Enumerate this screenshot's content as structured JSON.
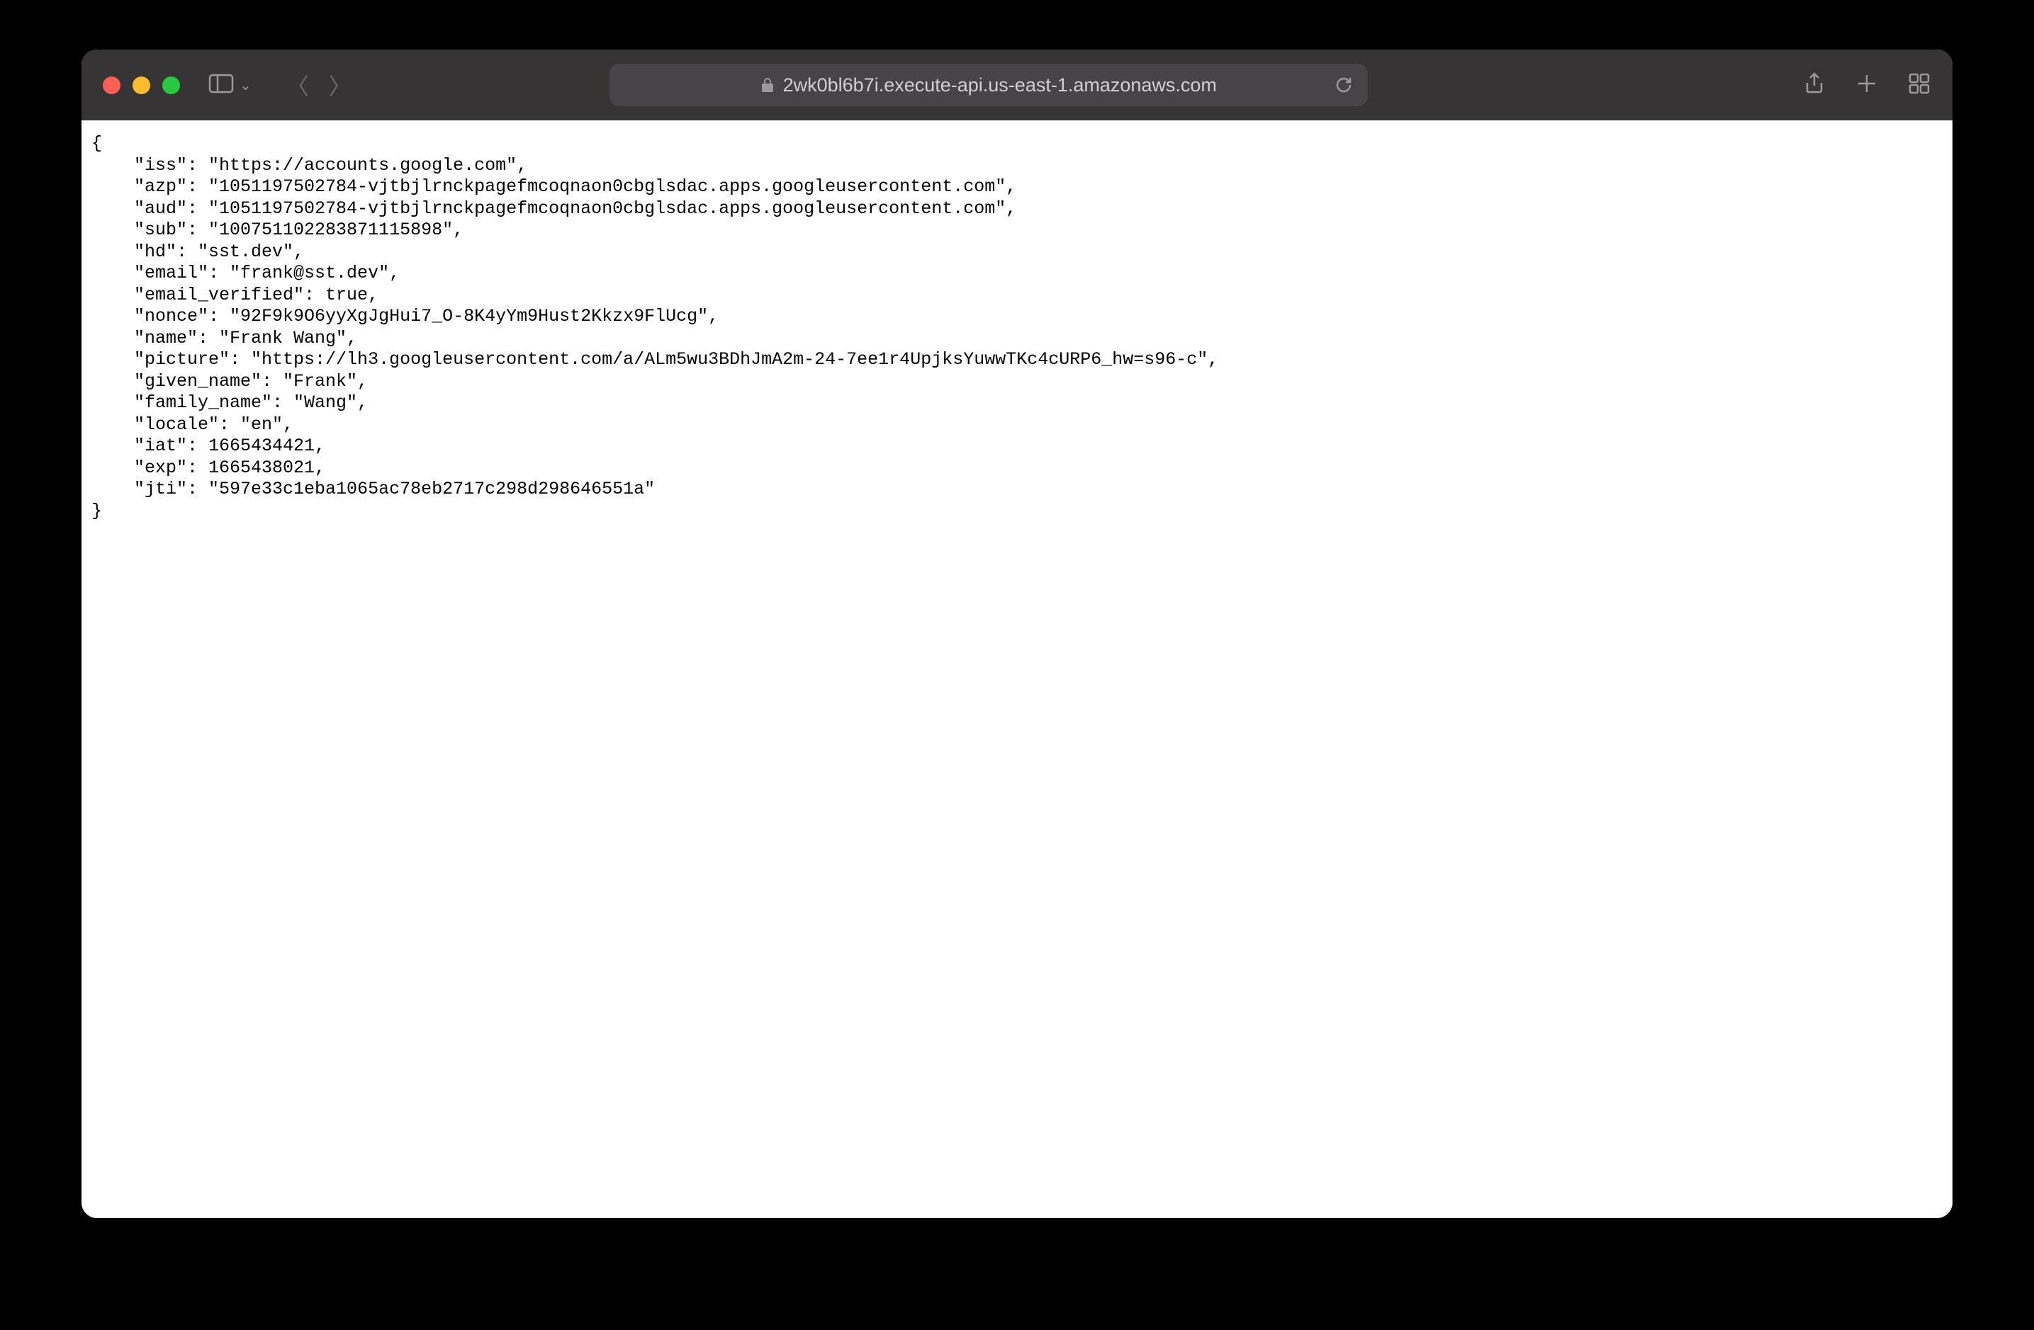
{
  "browser": {
    "url_display": "2wk0bl6b7i.execute-api.us-east-1.amazonaws.com"
  },
  "page": {
    "json_text": "{\n    \"iss\": \"https://accounts.google.com\",\n    \"azp\": \"1051197502784-vjtbjlrnckpagefmcoqnaon0cbglsdac.apps.googleusercontent.com\",\n    \"aud\": \"1051197502784-vjtbjlrnckpagefmcoqnaon0cbglsdac.apps.googleusercontent.com\",\n    \"sub\": \"100751102283871115898\",\n    \"hd\": \"sst.dev\",\n    \"email\": \"frank@sst.dev\",\n    \"email_verified\": true,\n    \"nonce\": \"92F9k9O6yyXgJgHui7_O-8K4yYm9Hust2Kkzx9FlUcg\",\n    \"name\": \"Frank Wang\",\n    \"picture\": \"https://lh3.googleusercontent.com/a/ALm5wu3BDhJmA2m-24-7ee1r4UpjksYuwwTKc4cURP6_hw=s96-c\",\n    \"given_name\": \"Frank\",\n    \"family_name\": \"Wang\",\n    \"locale\": \"en\",\n    \"iat\": 1665434421,\n    \"exp\": 1665438021,\n    \"jti\": \"597e33c1eba1065ac78eb2717c298d298646551a\"\n}"
  }
}
